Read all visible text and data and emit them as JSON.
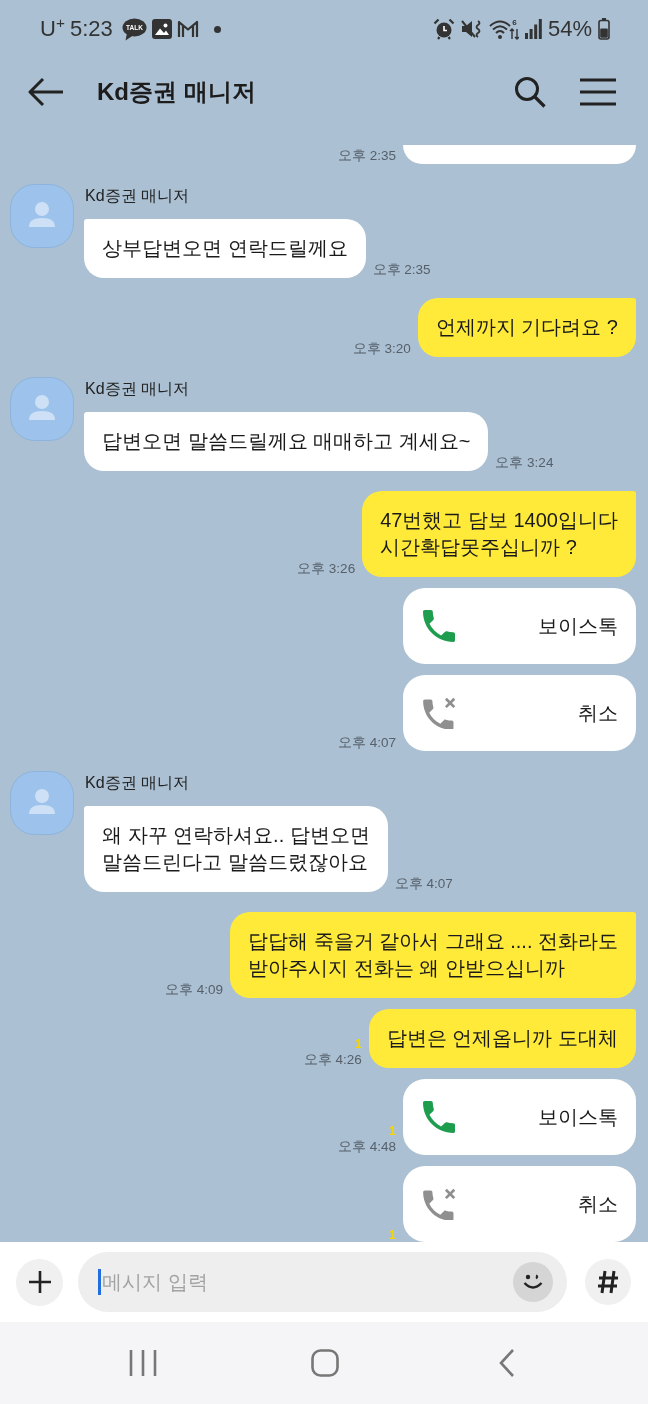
{
  "status_bar": {
    "carrier": "U$^{+}$",
    "time": "5:23",
    "notifications": [
      {
        "kind": "talk",
        "label": "TALK"
      },
      {
        "kind": "gallery"
      },
      {
        "kind": "mail"
      },
      {
        "kind": "dot"
      }
    ],
    "indicators": [
      {
        "kind": "alarm"
      },
      {
        "kind": "vibrate"
      },
      {
        "kind": "wifi",
        "label": "6"
      },
      {
        "kind": "signal"
      }
    ],
    "battery": "54%"
  },
  "header": {
    "title": "Kd증권 매니저"
  },
  "chat": {
    "messages": [
      {
        "kind": "clipped",
        "time": "오후 2:35"
      },
      {
        "kind": "incoming",
        "sender": "Kd증권 매니저",
        "text": "상부답변오면 연락드릴께요",
        "time": "오후 2:35"
      },
      {
        "kind": "outgoing",
        "text": "언제까지 기다려요 ?",
        "time": "오후 3:20"
      },
      {
        "kind": "incoming",
        "sender": "Kd증권 매니저",
        "text": "답변오면 말씀드릴께요 매매하고 계세요~",
        "time": "오후 3:24"
      },
      {
        "kind": "outgoing",
        "text": "47번했고 담보 1400입니다\n시간확답못주십니까 ?",
        "time": "오후 3:26"
      },
      {
        "kind": "call",
        "cancelled": false,
        "label": "보이스톡"
      },
      {
        "kind": "call",
        "cancelled": true,
        "label": "취소",
        "time": "오후 4:07"
      },
      {
        "kind": "incoming",
        "sender": "Kd증권 매니저",
        "text": "왜 자꾸 연락하셔요.. 답변오면\n말씀드린다고 말씀드렸잖아요",
        "time": "오후 4:07"
      },
      {
        "kind": "outgoing",
        "text": "답답해 죽을거 같아서 그래요 .... 전화라도\n받아주시지 전화는 왜 안받으십니까",
        "time": "오후 4:09"
      },
      {
        "kind": "outgoing",
        "text": "답변은 언제옵니까 도대체",
        "unread": "1",
        "time": "오후 4:26"
      },
      {
        "kind": "call",
        "cancelled": false,
        "label": "보이스톡",
        "unread": "1",
        "time": "오후 4:48"
      },
      {
        "kind": "call",
        "cancelled": true,
        "label": "취소",
        "unread": "1"
      }
    ]
  },
  "composer": {
    "placeholder": "메시지 입력",
    "focused": true
  }
}
